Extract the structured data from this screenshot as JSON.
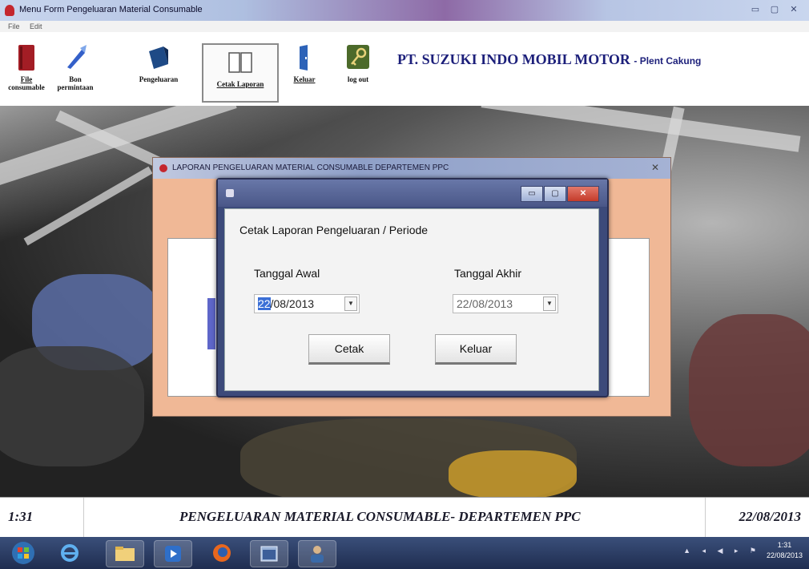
{
  "window": {
    "title": "Menu Form Pengeluaran Material Consumable",
    "controls": [
      "▭",
      "▢",
      "✕"
    ]
  },
  "menubar": {
    "items": [
      "File",
      "Edit"
    ]
  },
  "toolbar": {
    "buttons": [
      {
        "label_line1": "File",
        "label_line2": "consumable",
        "icon": "red-book-icon",
        "color": "#a31d25"
      },
      {
        "label_line1": "Bon",
        "label_line2": "permintaan",
        "icon": "quill-pen-icon",
        "color": "#3460c9"
      },
      {
        "label_line1": "Pengeluaran",
        "label_line2": "",
        "icon": "blue-box-icon",
        "color": "#1e4a86"
      },
      {
        "label_line1": "Cetak Laporan",
        "label_line2": "",
        "icon": "open-book-icon",
        "color": "#e6e6e6"
      },
      {
        "label_line1": "Keluar",
        "label_line2": "",
        "icon": "blue-door-icon",
        "color": "#2d63b8"
      },
      {
        "label_line1": "log out",
        "label_line2": "",
        "icon": "key-icon",
        "color": "#4c6a2a"
      }
    ],
    "company": "PT. SUZUKI INDO MOBIL MOTOR",
    "plant": "- Plent Cakung"
  },
  "inner_window": {
    "title": "LAPORAN PENGELUARAN MATERIAL CONSUMABLE DEPARTEMEN PPC",
    "close": "✕"
  },
  "dialog": {
    "heading": "Cetak Laporan Pengeluaran / Periode",
    "start_label": "Tanggal Awal",
    "end_label": "Tanggal Akhir",
    "start_value_selected": "22",
    "start_value_rest": "/08/2013",
    "end_value": "22/08/2013",
    "print_button": "Cetak",
    "exit_button": "Keluar",
    "dropdown_glyph": "▼"
  },
  "statusbar": {
    "time": "1:31",
    "caption": "PENGELUARAN MATERIAL CONSUMABLE- DEPARTEMEN PPC",
    "date": "22/08/2013"
  },
  "taskbar": {
    "clock_time": "1:31",
    "clock_date": "22/08/2013",
    "tray": "▲ ◂ ◀ ▸ ⚑"
  },
  "colors": {
    "accent": "#1c1f7a",
    "dialog_frame": "#3c4a7a",
    "inner_window_bg": "#f0b896",
    "taskbar": "#1f2d50"
  }
}
